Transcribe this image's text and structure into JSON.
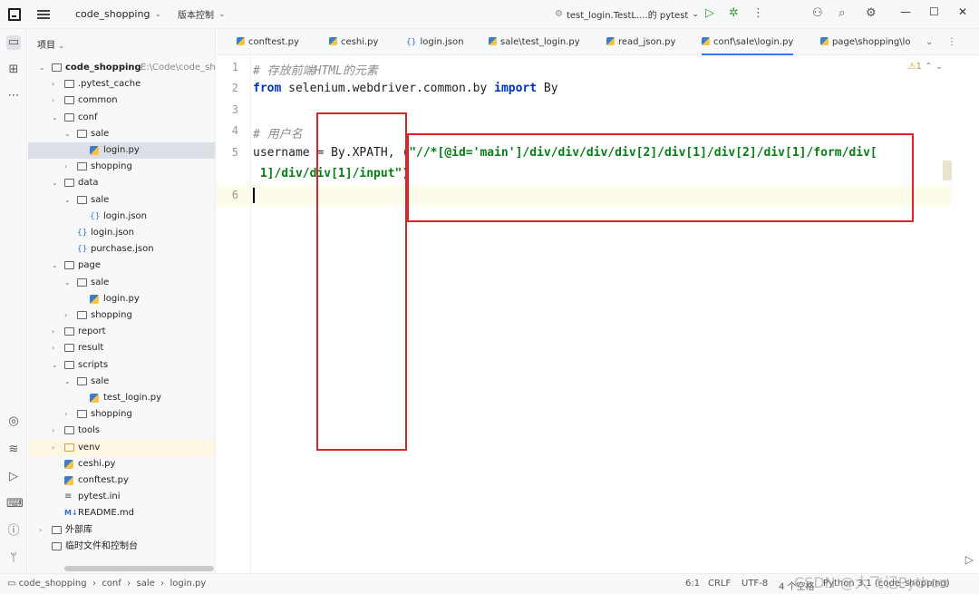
{
  "titlebar": {
    "project": "code_shopping",
    "vcs": "版本控制",
    "run_config": "test_login.TestL....的 pytest"
  },
  "project_panel": {
    "title": "项目"
  },
  "tree": [
    {
      "label": "code_shopping",
      "hint": "E:\\Code\\code_sho",
      "level": 0,
      "kind": "folder",
      "open": true,
      "bold": true
    },
    {
      "label": ".pytest_cache",
      "level": 1,
      "kind": "folder",
      "open": false
    },
    {
      "label": "common",
      "level": 1,
      "kind": "folder",
      "open": false
    },
    {
      "label": "conf",
      "level": 1,
      "kind": "folder",
      "open": true
    },
    {
      "label": "sale",
      "level": 2,
      "kind": "folder",
      "open": true
    },
    {
      "label": "login.py",
      "level": 3,
      "kind": "py",
      "selected": true
    },
    {
      "label": "shopping",
      "level": 2,
      "kind": "folder",
      "open": false
    },
    {
      "label": "data",
      "level": 1,
      "kind": "folder",
      "open": true
    },
    {
      "label": "sale",
      "level": 2,
      "kind": "folder",
      "open": true
    },
    {
      "label": "login.json",
      "level": 3,
      "kind": "json"
    },
    {
      "label": "login.json",
      "level": 2,
      "kind": "json"
    },
    {
      "label": "purchase.json",
      "level": 2,
      "kind": "json"
    },
    {
      "label": "page",
      "level": 1,
      "kind": "folder",
      "open": true
    },
    {
      "label": "sale",
      "level": 2,
      "kind": "folder",
      "open": true
    },
    {
      "label": "login.py",
      "level": 3,
      "kind": "py"
    },
    {
      "label": "shopping",
      "level": 2,
      "kind": "folder",
      "open": false
    },
    {
      "label": "report",
      "level": 1,
      "kind": "folder",
      "open": false
    },
    {
      "label": "result",
      "level": 1,
      "kind": "folder",
      "open": false
    },
    {
      "label": "scripts",
      "level": 1,
      "kind": "folder",
      "open": true
    },
    {
      "label": "sale",
      "level": 2,
      "kind": "folder",
      "open": true
    },
    {
      "label": "test_login.py",
      "level": 3,
      "kind": "py"
    },
    {
      "label": "shopping",
      "level": 2,
      "kind": "folder",
      "open": false
    },
    {
      "label": "tools",
      "level": 1,
      "kind": "folder",
      "open": false
    },
    {
      "label": "venv",
      "level": 1,
      "kind": "folder-orange",
      "open": false,
      "highlight": true
    },
    {
      "label": "ceshi.py",
      "level": 1,
      "kind": "py"
    },
    {
      "label": "conftest.py",
      "level": 1,
      "kind": "py"
    },
    {
      "label": "pytest.ini",
      "level": 1,
      "kind": "ini"
    },
    {
      "label": "README.md",
      "level": 1,
      "kind": "md"
    },
    {
      "label": "外部库",
      "level": 0,
      "kind": "lib",
      "open": false
    },
    {
      "label": "临时文件和控制台",
      "level": 0,
      "kind": "scratch"
    }
  ],
  "tabs": [
    {
      "label": "conftest.py",
      "icon": "py"
    },
    {
      "label": "ceshi.py",
      "icon": "py"
    },
    {
      "label": "login.json",
      "icon": "json"
    },
    {
      "label": "sale\\test_login.py",
      "icon": "py"
    },
    {
      "label": "read_json.py",
      "icon": "py"
    },
    {
      "label": "conf\\sale\\login.py",
      "icon": "py",
      "active": true
    },
    {
      "label": "page\\shopping\\lo",
      "icon": "py"
    }
  ],
  "editor": {
    "inspection_count": "1",
    "line_numbers": [
      "1",
      "2",
      "3",
      "4",
      "5",
      "",
      "6"
    ],
    "lines": {
      "l1": "# 存放前端HTML的元素",
      "l2_kw1": "from",
      "l2_mod": " selenium.webdriver.common.by ",
      "l2_kw2": "import",
      "l2_name": " By",
      "l4": "# 用户名",
      "l5_pre": "username = By.XPATH, (",
      "l5_str": "\"//*[@id='main']/div/div/div/div[2]/div[1]/div[2]/div[1]/form/div[",
      "l5b_str": " 1]/div/div[1]/input\"",
      "l5b_post": ")"
    }
  },
  "statusbar": {
    "crumbs": [
      "code_shopping",
      "conf",
      "sale",
      "login.py"
    ],
    "position": "6:1",
    "line_sep": "CRLF",
    "encoding": "UTF-8",
    "indent": "4 个空格",
    "interpreter": "Python 3.1 (code_shopping)",
    "watermark": "CSDN @大飞记Python"
  },
  "colors": {
    "accent": "#3574f0",
    "highlight_box": "#d9232e"
  }
}
